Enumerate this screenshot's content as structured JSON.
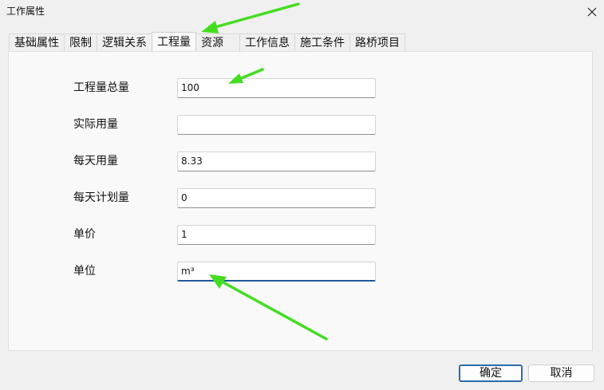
{
  "window": {
    "title": "工作属性"
  },
  "tabs": [
    {
      "label": "基础属性",
      "active": false
    },
    {
      "label": "限制",
      "active": false
    },
    {
      "label": "逻辑关系",
      "active": false
    },
    {
      "label": "工程量",
      "active": true
    },
    {
      "label": "资源",
      "active": false
    },
    {
      "label": "工作信息",
      "active": false
    },
    {
      "label": "施工条件",
      "active": false
    },
    {
      "label": "路桥项目",
      "active": false
    }
  ],
  "form": {
    "total_quantity": {
      "label": "工程量总量",
      "value": "100"
    },
    "actual_usage": {
      "label": "实际用量",
      "value": ""
    },
    "daily_usage": {
      "label": "每天用量",
      "value": "8.33"
    },
    "daily_planned": {
      "label": "每天计划量",
      "value": "0"
    },
    "unit_price": {
      "label": "单价",
      "value": "1"
    },
    "unit": {
      "label": "单位",
      "value": "m³"
    }
  },
  "buttons": {
    "ok": "确定",
    "cancel": "取消"
  },
  "annotation": {
    "arrow_color": "#44dd22"
  },
  "icons": {
    "close": "close-icon"
  }
}
